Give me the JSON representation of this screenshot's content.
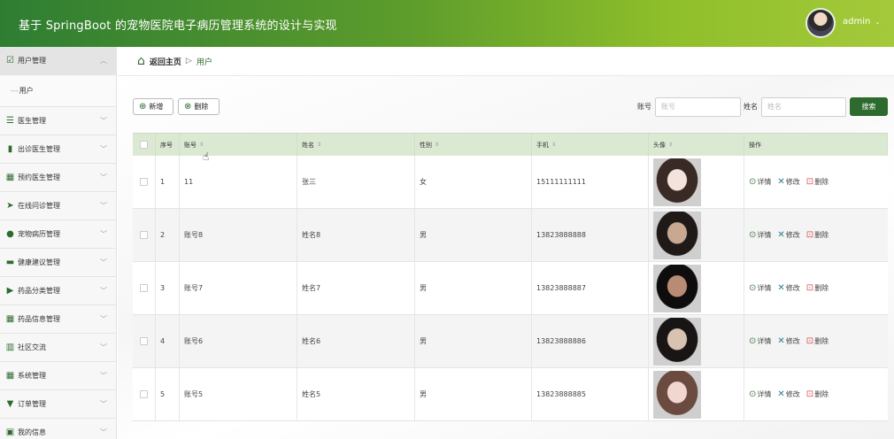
{
  "header": {
    "title": "基于 SpringBoot 的宠物医院电子病历管理系统的设计与实现",
    "username": "admin",
    "caret": "⌄"
  },
  "sidebar": {
    "items": [
      {
        "label": "用户管理",
        "icon": "user-check-icon",
        "glyph": "☑",
        "active": true,
        "expanded": true,
        "chevron": "︿"
      },
      {
        "label": "医生管理",
        "icon": "list-icon",
        "glyph": "☰",
        "chevron": "﹀"
      },
      {
        "label": "出诊医生管理",
        "icon": "bar-chart-icon",
        "glyph": "▮",
        "chevron": "﹀"
      },
      {
        "label": "预约医生管理",
        "icon": "grid-icon",
        "glyph": "▦",
        "chevron": "﹀"
      },
      {
        "label": "在线问诊管理",
        "icon": "send-icon",
        "glyph": "➤",
        "chevron": "﹀"
      },
      {
        "label": "宠物病历管理",
        "icon": "leaf-icon",
        "glyph": "●",
        "chevron": "﹀"
      },
      {
        "label": "健康建议管理",
        "icon": "card-icon",
        "glyph": "▬",
        "chevron": "﹀"
      },
      {
        "label": "药品分类管理",
        "icon": "tag-icon",
        "glyph": "▶",
        "chevron": "﹀"
      },
      {
        "label": "药品信息管理",
        "icon": "grid-icon",
        "glyph": "▦",
        "chevron": "﹀"
      },
      {
        "label": "社区交流",
        "icon": "book-icon",
        "glyph": "▥",
        "chevron": "﹀"
      },
      {
        "label": "系统管理",
        "icon": "grid-icon",
        "glyph": "▦",
        "chevron": "﹀"
      },
      {
        "label": "订单管理",
        "icon": "pin-icon",
        "glyph": "▼",
        "chevron": "﹀"
      },
      {
        "label": "我的信息",
        "icon": "window-icon",
        "glyph": "▣",
        "chevron": "﹀"
      }
    ],
    "subitems": [
      {
        "label": "用户",
        "dash": "---"
      }
    ]
  },
  "breadcrumb": {
    "home_label": "返回主页",
    "separator": "▷",
    "current": "用户"
  },
  "toolbar": {
    "add_label": "新增",
    "delete_label": "删除",
    "account_label": "账号",
    "account_placeholder": "账号",
    "name_label": "姓名",
    "name_placeholder": "姓名",
    "search_label": "搜索"
  },
  "table": {
    "headers": [
      "序号",
      "账号",
      "姓名",
      "性别",
      "手机",
      "头像",
      "操作"
    ],
    "sort_glyph": "⇕",
    "action_labels": {
      "view": "详情",
      "edit": "修改",
      "delete": "删除"
    },
    "rows": [
      {
        "index": "1",
        "account": "11",
        "name": "张三",
        "gender": "女",
        "phone": "15111111111",
        "photo_colors": [
          "#f3e3dc",
          "#3a2a26"
        ]
      },
      {
        "index": "2",
        "account": "账号8",
        "name": "姓名8",
        "gender": "男",
        "phone": "13823888888",
        "photo_colors": [
          "#c8a890",
          "#1f1a18"
        ]
      },
      {
        "index": "3",
        "account": "账号7",
        "name": "姓名7",
        "gender": "男",
        "phone": "13823888887",
        "photo_colors": [
          "#b88c74",
          "#0e0c0c"
        ]
      },
      {
        "index": "4",
        "account": "账号6",
        "name": "姓名6",
        "gender": "男",
        "phone": "13823888886",
        "photo_colors": [
          "#d8c2b2",
          "#191515"
        ]
      },
      {
        "index": "5",
        "account": "账号5",
        "name": "姓名5",
        "gender": "男",
        "phone": "13823888885",
        "photo_colors": [
          "#f2d7d0",
          "#6b4a40"
        ]
      }
    ]
  },
  "colors": {
    "brand_green": "#2d6a2d",
    "header_gradient_end": "#a4c93a",
    "table_header_bg": "#dbe9d3",
    "delete_red": "#d9534f"
  }
}
